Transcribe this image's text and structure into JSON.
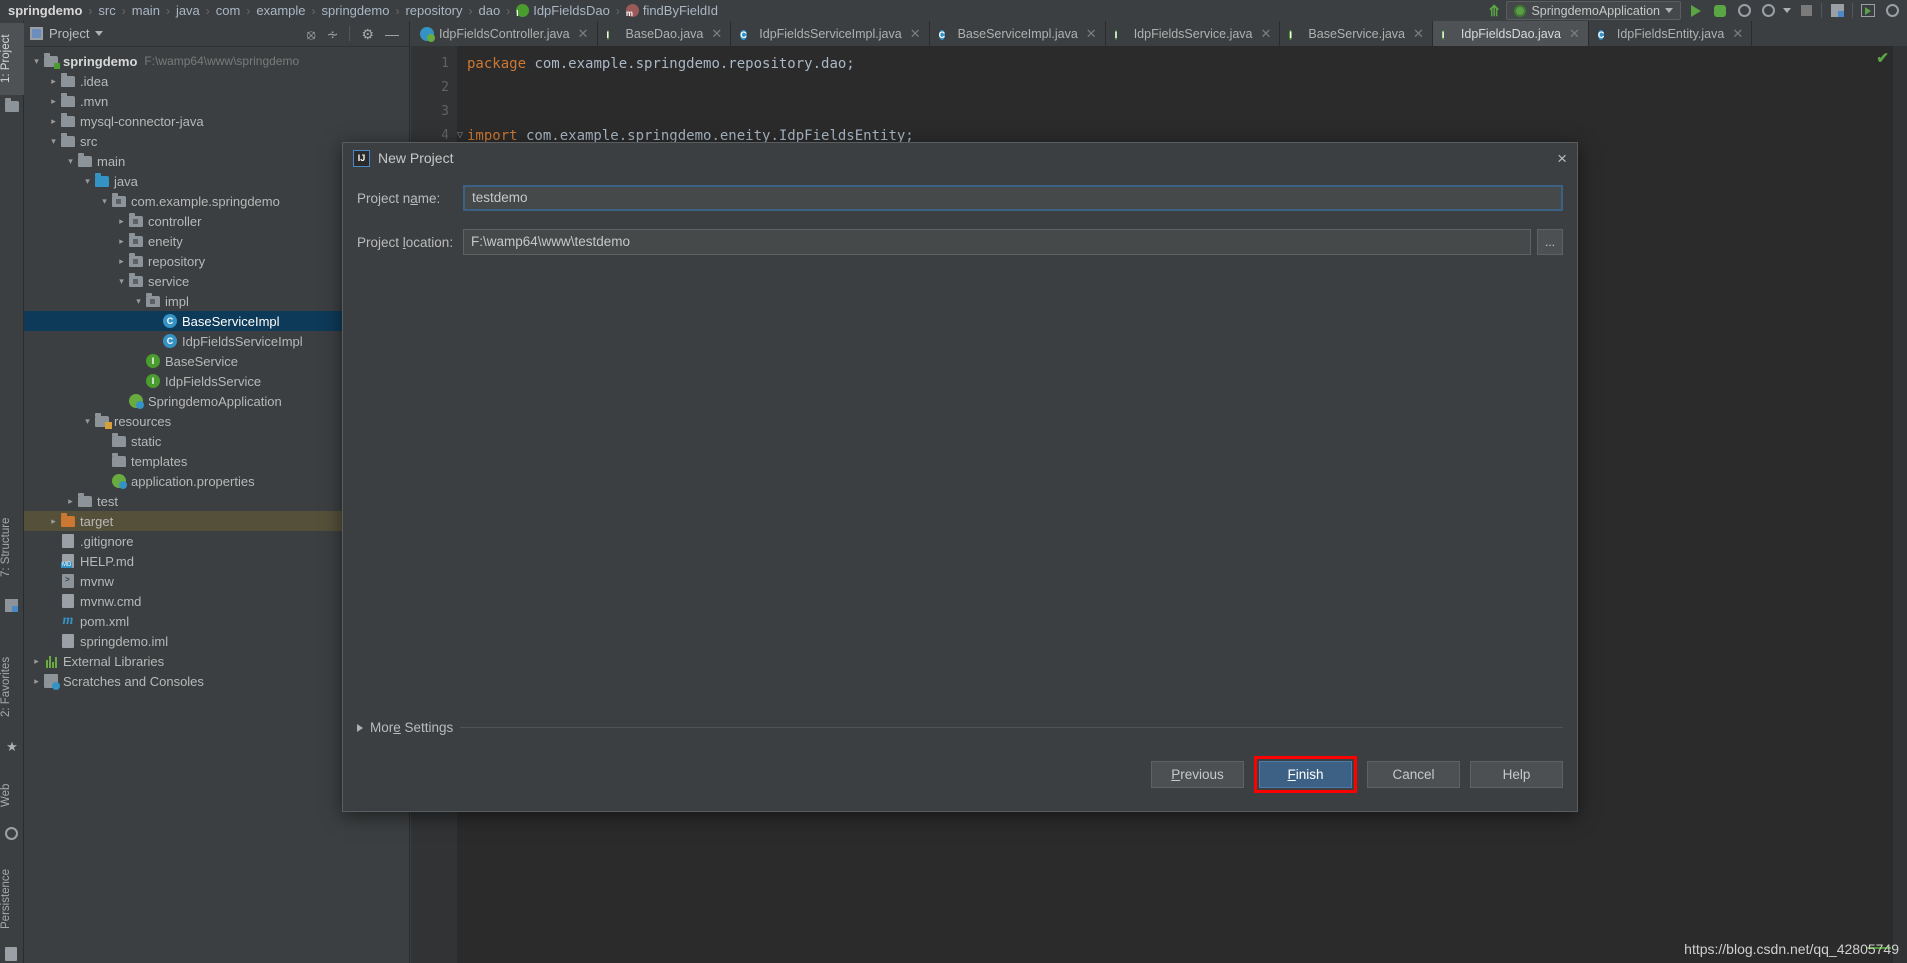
{
  "breadcrumb": [
    {
      "label": "springdemo",
      "bold": true,
      "icon": null
    },
    {
      "label": "src",
      "bold": false,
      "icon": null
    },
    {
      "label": "main",
      "bold": false,
      "icon": null
    },
    {
      "label": "java",
      "bold": false,
      "icon": null
    },
    {
      "label": "com",
      "bold": false,
      "icon": null
    },
    {
      "label": "example",
      "bold": false,
      "icon": null
    },
    {
      "label": "springdemo",
      "bold": false,
      "icon": null
    },
    {
      "label": "repository",
      "bold": false,
      "icon": null
    },
    {
      "label": "dao",
      "bold": false,
      "icon": null
    },
    {
      "label": "IdpFieldsDao",
      "bold": false,
      "icon": "interface-icon"
    },
    {
      "label": "findByFieldId",
      "bold": false,
      "icon": "method-icon"
    }
  ],
  "toolbar": {
    "run_config": "SpringdemoApplication",
    "icons": [
      "run-icon",
      "debug-icon",
      "run-with-coverage-icon",
      "profiler-icon",
      "stop-icon",
      "layout-icon",
      "run-anything-icon",
      "search-everywhere-icon"
    ]
  },
  "tool_strip_left": [
    {
      "label": "1: Project",
      "active": true
    },
    {
      "label": "7: Structure",
      "active": false
    },
    {
      "label": "2: Favorites",
      "active": false
    },
    {
      "label": "Web",
      "active": false
    },
    {
      "label": "Persistence",
      "active": false
    }
  ],
  "project_panel": {
    "title": "Project",
    "tree": [
      {
        "depth": 0,
        "arrow": "v",
        "icon": "folder-module",
        "label": "springdemo",
        "bold": true,
        "path": "F:\\wamp64\\www\\springdemo",
        "state": "normal"
      },
      {
        "depth": 1,
        "arrow": ">",
        "icon": "folder",
        "label": ".idea",
        "state": "normal"
      },
      {
        "depth": 1,
        "arrow": ">",
        "icon": "folder",
        "label": ".mvn",
        "state": "normal"
      },
      {
        "depth": 1,
        "arrow": ">",
        "icon": "folder",
        "label": "mysql-connector-java",
        "state": "normal"
      },
      {
        "depth": 1,
        "arrow": "v",
        "icon": "folder",
        "label": "src",
        "state": "normal"
      },
      {
        "depth": 2,
        "arrow": "v",
        "icon": "folder",
        "label": "main",
        "state": "normal"
      },
      {
        "depth": 3,
        "arrow": "v",
        "icon": "folder-source",
        "label": "java",
        "state": "normal"
      },
      {
        "depth": 4,
        "arrow": "v",
        "icon": "folder-package",
        "label": "com.example.springdemo",
        "state": "normal"
      },
      {
        "depth": 5,
        "arrow": ">",
        "icon": "folder-package",
        "label": "controller",
        "state": "normal"
      },
      {
        "depth": 5,
        "arrow": ">",
        "icon": "folder-package",
        "label": "eneity",
        "state": "normal"
      },
      {
        "depth": 5,
        "arrow": ">",
        "icon": "folder-package",
        "label": "repository",
        "state": "normal"
      },
      {
        "depth": 5,
        "arrow": "v",
        "icon": "folder-package",
        "label": "service",
        "state": "normal"
      },
      {
        "depth": 6,
        "arrow": "v",
        "icon": "folder-package",
        "label": "impl",
        "state": "normal"
      },
      {
        "depth": 7,
        "arrow": "",
        "icon": "class",
        "label": "BaseServiceImpl",
        "state": "selected"
      },
      {
        "depth": 7,
        "arrow": "",
        "icon": "class",
        "label": "IdpFieldsServiceImpl",
        "state": "normal"
      },
      {
        "depth": 6,
        "arrow": "",
        "icon": "interface",
        "label": "BaseService",
        "state": "normal"
      },
      {
        "depth": 6,
        "arrow": "",
        "icon": "interface",
        "label": "IdpFieldsService",
        "state": "normal"
      },
      {
        "depth": 5,
        "arrow": "",
        "icon": "spring",
        "label": "SpringdemoApplication",
        "state": "normal"
      },
      {
        "depth": 3,
        "arrow": "v",
        "icon": "folder-resource",
        "label": "resources",
        "state": "normal"
      },
      {
        "depth": 4,
        "arrow": "",
        "icon": "folder",
        "label": "static",
        "state": "normal"
      },
      {
        "depth": 4,
        "arrow": "",
        "icon": "folder",
        "label": "templates",
        "state": "normal"
      },
      {
        "depth": 4,
        "arrow": "",
        "icon": "spring",
        "label": "application.properties",
        "state": "normal"
      },
      {
        "depth": 2,
        "arrow": ">",
        "icon": "folder",
        "label": "test",
        "state": "normal"
      },
      {
        "depth": 1,
        "arrow": ">",
        "icon": "folder-excluded",
        "label": "target",
        "state": "hovered"
      },
      {
        "depth": 1,
        "arrow": "",
        "icon": "file",
        "label": ".gitignore",
        "state": "normal"
      },
      {
        "depth": 1,
        "arrow": "",
        "icon": "file-md",
        "label": "HELP.md",
        "state": "normal"
      },
      {
        "depth": 1,
        "arrow": "",
        "icon": "file-bat",
        "label": "mvnw",
        "state": "normal"
      },
      {
        "depth": 1,
        "arrow": "",
        "icon": "file",
        "label": "mvnw.cmd",
        "state": "normal"
      },
      {
        "depth": 1,
        "arrow": "",
        "icon": "maven",
        "label": "pom.xml",
        "state": "normal"
      },
      {
        "depth": 1,
        "arrow": "",
        "icon": "file",
        "label": "springdemo.iml",
        "state": "normal"
      },
      {
        "depth": 0,
        "arrow": ">",
        "icon": "libraries",
        "label": "External Libraries",
        "state": "normal"
      },
      {
        "depth": 0,
        "arrow": ">",
        "icon": "scratches",
        "label": "Scratches and Consoles",
        "state": "normal"
      }
    ],
    "header_icons": [
      "locate-icon",
      "collapse-all-icon",
      "gear-icon",
      "hide-icon"
    ]
  },
  "editor": {
    "tabs": [
      {
        "label": "IdpFieldsController.java",
        "icon": "spring-controller-icon",
        "active": false
      },
      {
        "label": "BaseDao.java",
        "icon": "interface-icon",
        "active": false
      },
      {
        "label": "IdpFieldsServiceImpl.java",
        "icon": "class-icon",
        "active": false
      },
      {
        "label": "BaseServiceImpl.java",
        "icon": "class-icon",
        "active": false
      },
      {
        "label": "IdpFieldsService.java",
        "icon": "interface-icon",
        "active": false
      },
      {
        "label": "BaseService.java",
        "icon": "interface-icon",
        "active": false
      },
      {
        "label": "IdpFieldsDao.java",
        "icon": "interface-icon",
        "active": true
      },
      {
        "label": "IdpFieldsEntity.java",
        "icon": "class-icon",
        "active": false
      }
    ],
    "line_numbers": [
      "1",
      "2",
      "3",
      "4"
    ],
    "lines": [
      {
        "keyword": "package",
        "rest": " com.example.springdemo.repository.dao;",
        "fold": false
      },
      {
        "keyword": "",
        "rest": "",
        "fold": false
      },
      {
        "keyword": "",
        "rest": "",
        "fold": false
      },
      {
        "keyword": "import",
        "rest": " com.example.springdemo.eneity.IdpFieldsEntity;",
        "fold": true
      }
    ]
  },
  "dialog": {
    "title": "New Project",
    "close_label": "×",
    "fields": [
      {
        "label_pre": "Project n",
        "label_mn": "a",
        "label_post": "me:",
        "value": "testdemo",
        "focused": true,
        "browse": false
      },
      {
        "label_pre": "Project ",
        "label_mn": "l",
        "label_post": "ocation:",
        "value": "F:\\wamp64\\www\\testdemo",
        "focused": false,
        "browse": true
      }
    ],
    "browse_label": "...",
    "more_settings": {
      "pre": "Mor",
      "mn": "e",
      "post": " Settings"
    },
    "buttons": [
      {
        "pre": "",
        "mn": "P",
        "post": "revious",
        "primary": false,
        "highlight": false
      },
      {
        "pre": "",
        "mn": "F",
        "post": "inish",
        "primary": true,
        "highlight": true
      },
      {
        "pre": "Cancel",
        "mn": "",
        "post": "",
        "primary": false,
        "highlight": false
      },
      {
        "pre": "Help",
        "mn": "",
        "post": "",
        "primary": false,
        "highlight": false
      }
    ]
  },
  "watermark": "https://blog.csdn.net/qq_42805749",
  "colors": {
    "background": "#3c3f41",
    "editor_background": "#2b2b2b",
    "accent_blue": "#3592c4",
    "selection": "#0d3a58",
    "keyword_orange": "#cc7832",
    "interface_green": "#4a9c2f",
    "highlight_red": "#ff0000"
  }
}
